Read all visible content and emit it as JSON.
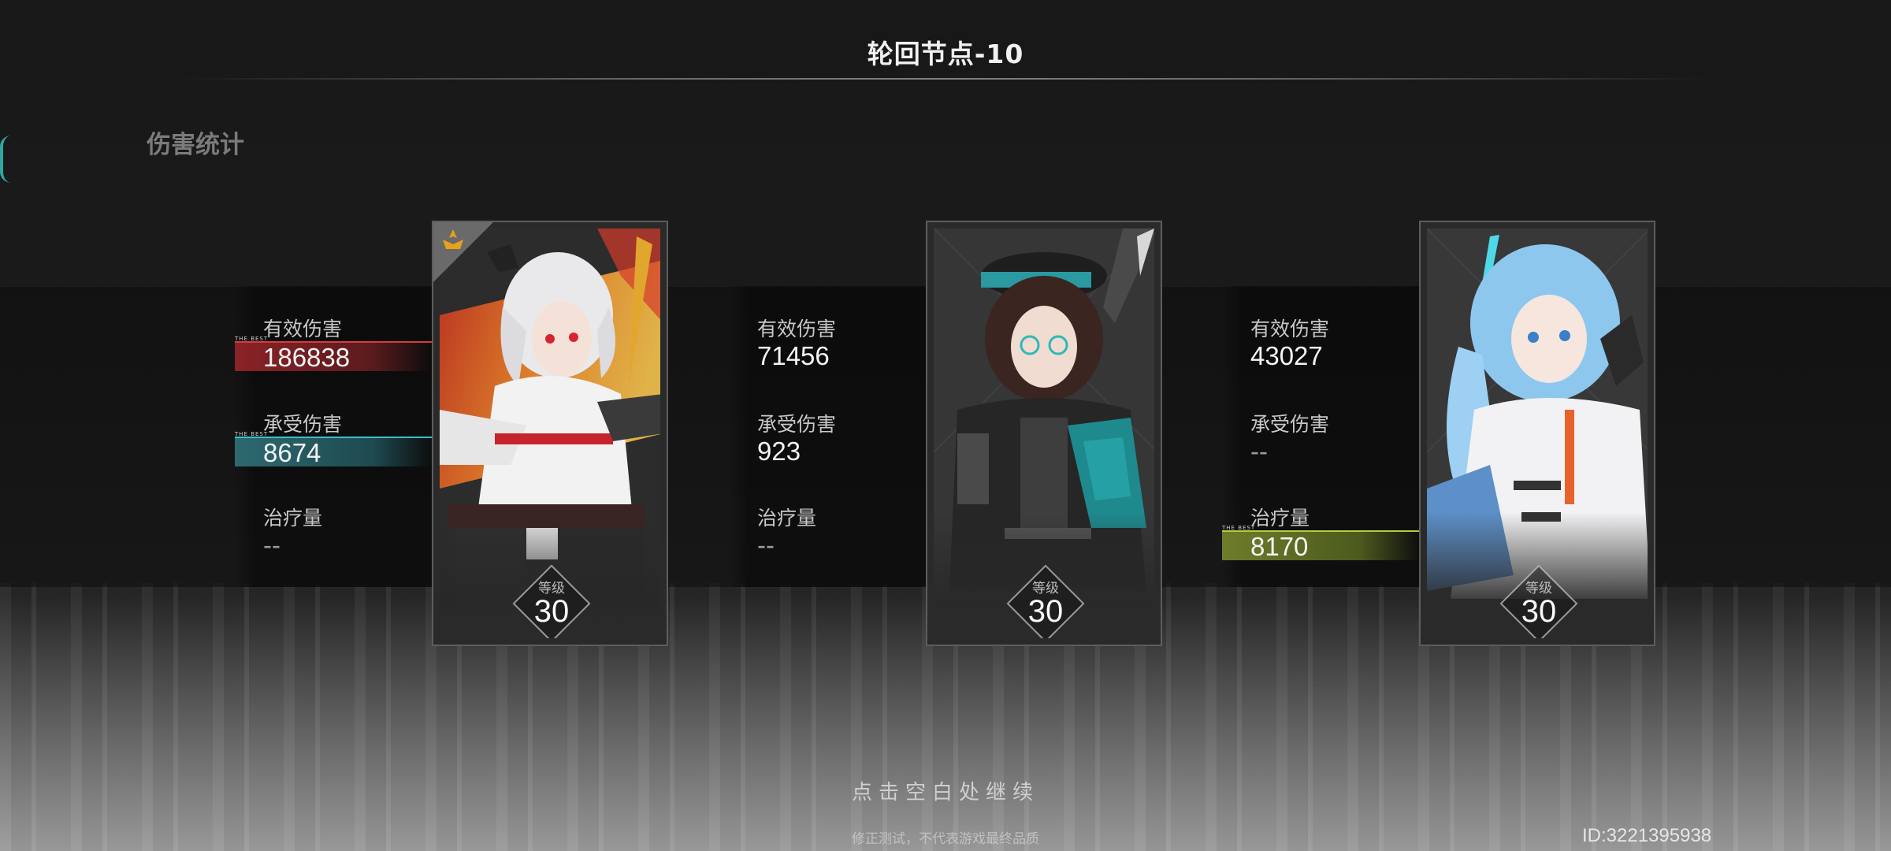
{
  "header": {
    "title": "轮回节点-10"
  },
  "section": {
    "title": "伤害统计"
  },
  "labels": {
    "damage": "有效伤害",
    "taken": "承受伤害",
    "heal": "治疗量",
    "best_tag": "THE BEST",
    "level": "等级"
  },
  "characters": [
    {
      "damage": "186838",
      "taken": "8674",
      "heal": "--",
      "level": "30",
      "best_damage": true,
      "best_taken": true,
      "best_heal": false,
      "mvp": true
    },
    {
      "damage": "71456",
      "taken": "923",
      "heal": "--",
      "level": "30",
      "best_damage": false,
      "best_taken": false,
      "best_heal": false,
      "mvp": false
    },
    {
      "damage": "43027",
      "taken": "--",
      "heal": "8170",
      "level": "30",
      "best_damage": false,
      "best_taken": false,
      "best_heal": true,
      "mvp": false
    }
  ],
  "footer": {
    "continue": "点击空白处继续",
    "disclaimer": "修正测试，不代表游戏最终品质",
    "id": "ID:3221395938"
  },
  "colors": {
    "damage_highlight": "#8a2227",
    "taken_highlight": "#2c6a70",
    "heal_highlight": "#6e7d2a",
    "mvp_icon": "#e8a21a"
  }
}
